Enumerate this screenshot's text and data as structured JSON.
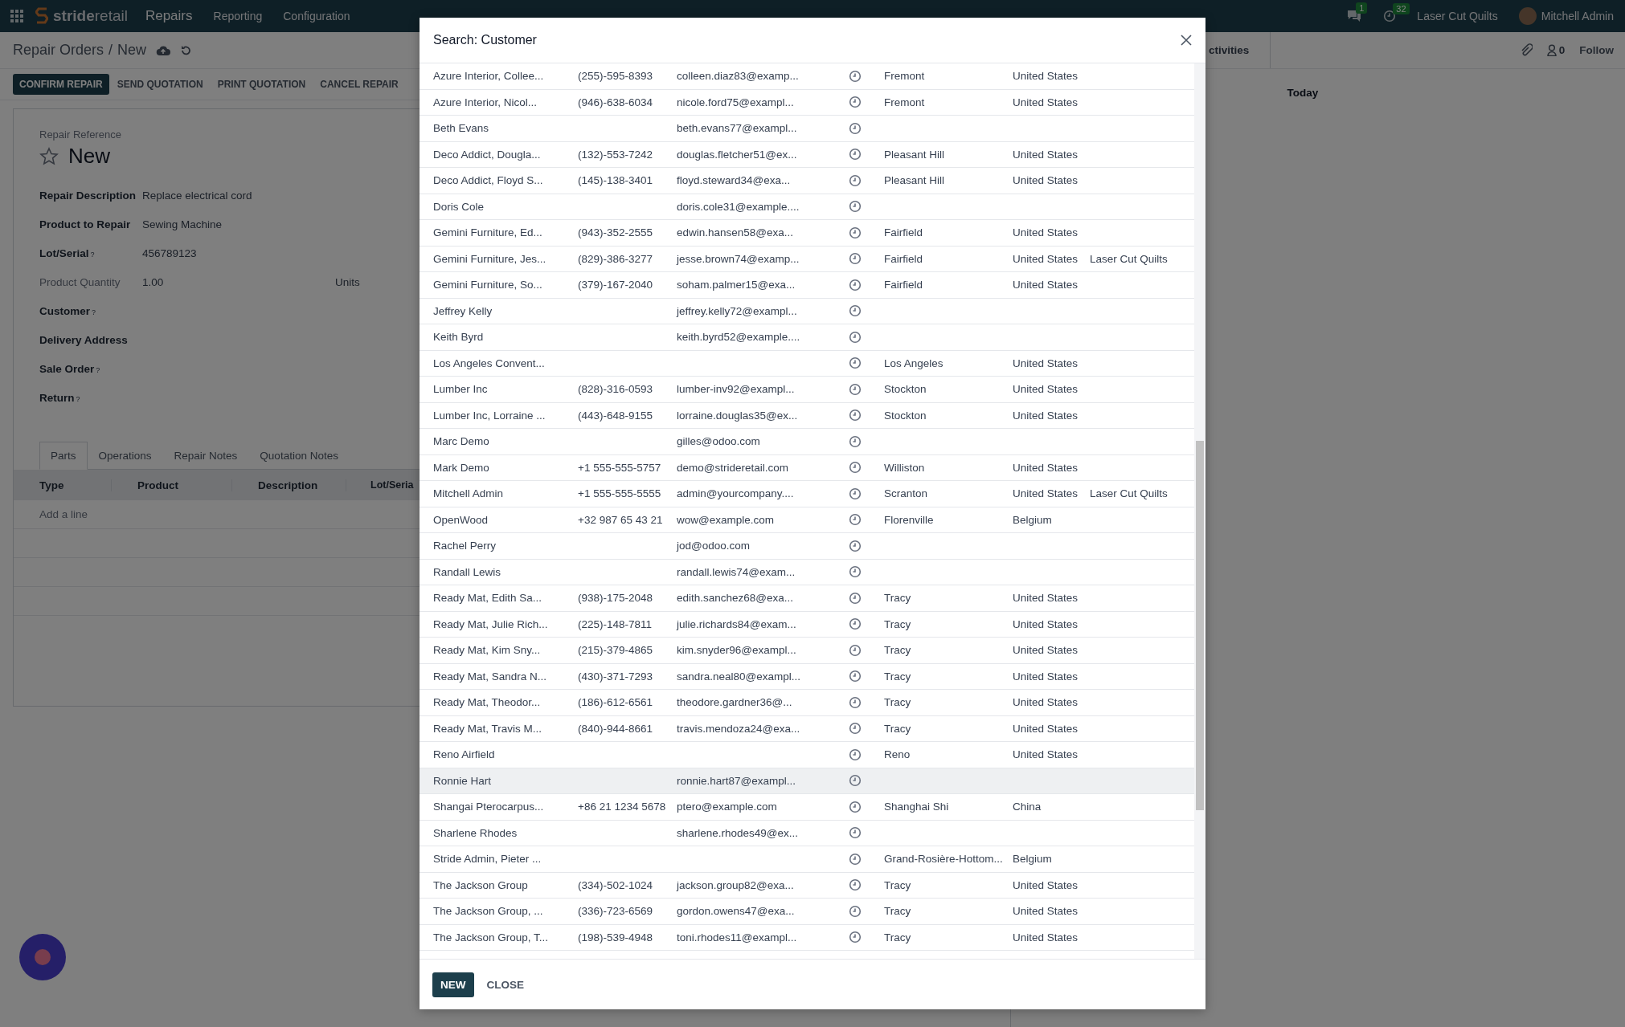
{
  "navbar": {
    "brand": "**stride**retail",
    "app_name": "Repairs",
    "menu": [
      "Reporting",
      "Configuration"
    ],
    "messages_badge": "1",
    "activities_badge": "32",
    "company": "Laser Cut Quilts",
    "user": "Mitchell Admin"
  },
  "breadcrumb": {
    "parent": "Repair Orders",
    "separator": "/",
    "current": "New"
  },
  "actions": [
    {
      "label": "CONFIRM REPAIR",
      "primary": true
    },
    {
      "label": "SEND QUOTATION",
      "primary": false
    },
    {
      "label": "PRINT QUOTATION",
      "primary": false
    },
    {
      "label": "CANCEL REPAIR",
      "primary": false
    }
  ],
  "chatter": {
    "activities": "ctivities",
    "followers_count": "0",
    "follow": "Follow",
    "today": "Today"
  },
  "form": {
    "reference_label": "Repair Reference",
    "name": "New",
    "starred": false,
    "fields": [
      {
        "label": "Repair Description",
        "value": "Replace electrical cord",
        "muted": false
      },
      {
        "label": "Product to Repair",
        "value": "Sewing Machine",
        "muted": false
      },
      {
        "label": "Lot/Serial",
        "help": "?",
        "value": "456789123",
        "muted": false
      },
      {
        "label": "Product Quantity",
        "value": "1.00",
        "unit": "Units",
        "muted": true
      },
      {
        "label": "Customer",
        "help": "?",
        "muted": false
      },
      {
        "label": "Delivery Address",
        "muted": false
      },
      {
        "label": "Sale Order",
        "help": "?",
        "muted": false
      },
      {
        "label": "Return",
        "help": "?",
        "muted": false
      }
    ],
    "tabs": [
      {
        "label": "Parts",
        "selected": true
      },
      {
        "label": "Operations",
        "selected": false
      },
      {
        "label": "Repair Notes",
        "selected": false
      },
      {
        "label": "Quotation Notes",
        "selected": false
      }
    ],
    "lines_table": {
      "columns": [
        "Type",
        "Product",
        "Description",
        "Lot/Seria"
      ],
      "add_line": "Add a line"
    }
  },
  "dialog": {
    "title": "Search: Customer",
    "rows": [
      {
        "name": "Azure Interior, Collee...",
        "phone": "(255)-595-8393",
        "email": "colleen.diaz83@examp...",
        "city": "Fremont",
        "country": "United States",
        "hovered": false
      },
      {
        "name": "Azure Interior, Nicol...",
        "phone": "(946)-638-6034",
        "email": "nicole.ford75@exampl...",
        "city": "Fremont",
        "country": "United States",
        "hovered": false
      },
      {
        "name": "Beth Evans",
        "email": "beth.evans77@exampl...",
        "hovered": false
      },
      {
        "name": "Deco Addict, Dougla...",
        "phone": "(132)-553-7242",
        "email": "douglas.fletcher51@ex...",
        "city": "Pleasant Hill",
        "country": "United States",
        "hovered": false
      },
      {
        "name": "Deco Addict, Floyd S...",
        "phone": "(145)-138-3401",
        "email": "floyd.steward34@exa...",
        "city": "Pleasant Hill",
        "country": "United States",
        "hovered": false
      },
      {
        "name": "Doris Cole",
        "email": "doris.cole31@example....",
        "hovered": false
      },
      {
        "name": "Gemini Furniture, Ed...",
        "phone": "(943)-352-2555",
        "email": "edwin.hansen58@exa...",
        "city": "Fairfield",
        "country": "United States",
        "hovered": false
      },
      {
        "name": "Gemini Furniture, Jes...",
        "phone": "(829)-386-3277",
        "email": "jesse.brown74@examp...",
        "city": "Fairfield",
        "country": "United States",
        "company": "Laser Cut Quilts",
        "hovered": false
      },
      {
        "name": "Gemini Furniture, So...",
        "phone": "(379)-167-2040",
        "email": "soham.palmer15@exa...",
        "city": "Fairfield",
        "country": "United States",
        "hovered": false
      },
      {
        "name": "Jeffrey Kelly",
        "email": "jeffrey.kelly72@exampl...",
        "hovered": false
      },
      {
        "name": "Keith Byrd",
        "email": "keith.byrd52@example....",
        "hovered": false
      },
      {
        "name": "Los Angeles Convent...",
        "city": "Los Angeles",
        "country": "United States",
        "hovered": false
      },
      {
        "name": "Lumber Inc",
        "phone": "(828)-316-0593",
        "email": "lumber-inv92@exampl...",
        "city": "Stockton",
        "country": "United States",
        "hovered": false
      },
      {
        "name": "Lumber Inc, Lorraine ...",
        "phone": "(443)-648-9155",
        "email": "lorraine.douglas35@ex...",
        "city": "Stockton",
        "country": "United States",
        "hovered": false
      },
      {
        "name": "Marc Demo",
        "email": "gilles@odoo.com",
        "hovered": false
      },
      {
        "name": "Mark Demo",
        "phone": "+1 555-555-5757",
        "email": "demo@strideretail.com",
        "city": "Williston",
        "country": "United States",
        "hovered": false
      },
      {
        "name": "Mitchell Admin",
        "phone": "+1 555-555-5555",
        "email": "admin@yourcompany....",
        "city": "Scranton",
        "country": "United States",
        "company": "Laser Cut Quilts",
        "hovered": false
      },
      {
        "name": "OpenWood",
        "phone": "+32 987 65 43 21",
        "email": "wow@example.com",
        "city": "Florenville",
        "country": "Belgium",
        "hovered": false
      },
      {
        "name": "Rachel Perry",
        "email": "jod@odoo.com",
        "hovered": false
      },
      {
        "name": "Randall Lewis",
        "email": "randall.lewis74@exam...",
        "hovered": false
      },
      {
        "name": "Ready Mat, Edith Sa...",
        "phone": "(938)-175-2048",
        "email": "edith.sanchez68@exa...",
        "city": "Tracy",
        "country": "United States",
        "hovered": false
      },
      {
        "name": "Ready Mat, Julie Rich...",
        "phone": "(225)-148-7811",
        "email": "julie.richards84@exam...",
        "city": "Tracy",
        "country": "United States",
        "hovered": false
      },
      {
        "name": "Ready Mat, Kim Sny...",
        "phone": "(215)-379-4865",
        "email": "kim.snyder96@exampl...",
        "city": "Tracy",
        "country": "United States",
        "hovered": false
      },
      {
        "name": "Ready Mat, Sandra N...",
        "phone": "(430)-371-7293",
        "email": "sandra.neal80@exampl...",
        "city": "Tracy",
        "country": "United States",
        "hovered": false
      },
      {
        "name": "Ready Mat, Theodor...",
        "phone": "(186)-612-6561",
        "email": "theodore.gardner36@...",
        "city": "Tracy",
        "country": "United States",
        "hovered": false
      },
      {
        "name": "Ready Mat, Travis M...",
        "phone": "(840)-944-8661",
        "email": "travis.mendoza24@exa...",
        "city": "Tracy",
        "country": "United States",
        "hovered": false
      },
      {
        "name": "Reno Airfield",
        "city": "Reno",
        "country": "United States",
        "hovered": false
      },
      {
        "name": "Ronnie Hart",
        "email": "ronnie.hart87@exampl...",
        "hovered": true
      },
      {
        "name": "Shangai Pterocarpus...",
        "phone": "+86 21 1234 5678",
        "email": "ptero@example.com",
        "city": "Shanghai Shi",
        "country": "China",
        "hovered": false
      },
      {
        "name": "Sharlene Rhodes",
        "email": "sharlene.rhodes49@ex...",
        "hovered": false
      },
      {
        "name": "Stride Admin, Pieter ...",
        "city": "Grand-Rosière-Hottom...",
        "country": "Belgium",
        "hovered": false
      },
      {
        "name": "The Jackson Group",
        "phone": "(334)-502-1024",
        "email": "jackson.group82@exa...",
        "city": "Tracy",
        "country": "United States",
        "hovered": false
      },
      {
        "name": "The Jackson Group, ...",
        "phone": "(336)-723-6569",
        "email": "gordon.owens47@exa...",
        "city": "Tracy",
        "country": "United States",
        "hovered": false
      },
      {
        "name": "The Jackson Group, T...",
        "phone": "(198)-539-4948",
        "email": "toni.rhodes11@exampl...",
        "city": "Tracy",
        "country": "United States",
        "hovered": false
      }
    ],
    "buttons": [
      {
        "label": "NEW",
        "primary": true
      },
      {
        "label": "CLOSE",
        "primary": false
      }
    ]
  }
}
